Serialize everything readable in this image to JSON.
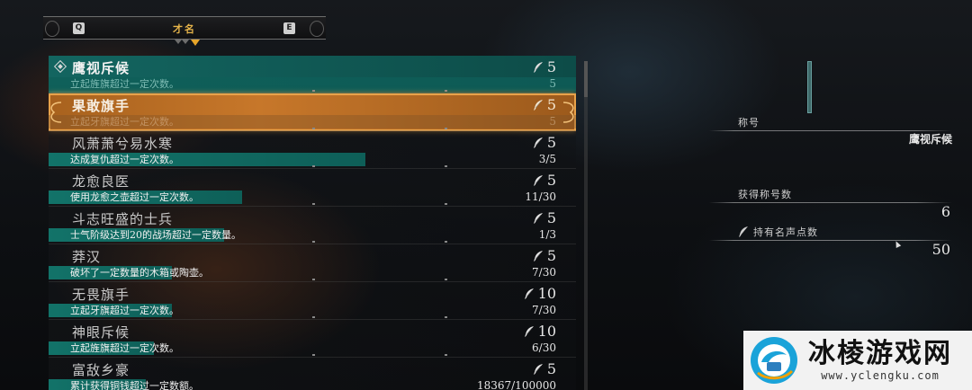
{
  "tabs": {
    "left_key": "Q",
    "right_key": "E",
    "title": "才名"
  },
  "titles": [
    {
      "name": "鹰视斥候",
      "description": "立起旌旗超过一定次数。",
      "progress": "5",
      "reward": "5",
      "fraction": 1.0,
      "state": "equipped"
    },
    {
      "name": "果敢旗手",
      "description": "立起牙旗超过一定次数。",
      "progress": "5",
      "reward": "5",
      "fraction": 1.0,
      "state": "selected"
    },
    {
      "name": "风萧萧兮易水寒",
      "description": "达成复仇超过一定次数。",
      "progress": "3/5",
      "reward": "5",
      "fraction": 0.6
    },
    {
      "name": "龙愈良医",
      "description": "使用龙愈之壶超过一定次数。",
      "progress": "11/30",
      "reward": "5",
      "fraction": 0.367
    },
    {
      "name": "斗志旺盛的士兵",
      "description": "士气阶级达到20的战场超过一定数量。",
      "progress": "1/3",
      "reward": "5",
      "fraction": 0.333
    },
    {
      "name": "莽汉",
      "description": "破坏了一定数量的木箱或陶壶。",
      "progress": "7/30",
      "reward": "5",
      "fraction": 0.233
    },
    {
      "name": "无畏旗手",
      "description": "立起牙旗超过一定次数。",
      "progress": "7/30",
      "reward": "10",
      "fraction": 0.233
    },
    {
      "name": "神眼斥候",
      "description": "立起旌旗超过一定次数。",
      "progress": "6/30",
      "reward": "10",
      "fraction": 0.2
    },
    {
      "name": "富敌乡豪",
      "description": "累计获得铜钱超过一定数额。",
      "progress": "18367/100000",
      "reward": "5",
      "fraction": 0.184
    }
  ],
  "info": {
    "title_label": "称号",
    "title_value": "鹰视斥候",
    "obtained_label": "获得称号数",
    "obtained_value": "6",
    "fame_label": "持有名声点数",
    "fame_value": "50"
  },
  "watermark": {
    "title": "冰棱游戏网",
    "url": "www.yclengku.com"
  },
  "colors": {
    "accent_teal": "#127369",
    "selected_orange": "#c7772a",
    "tab_gold": "#e6b44a"
  },
  "icons": {
    "reward": "feather-icon",
    "equipped": "diamond-icon"
  }
}
